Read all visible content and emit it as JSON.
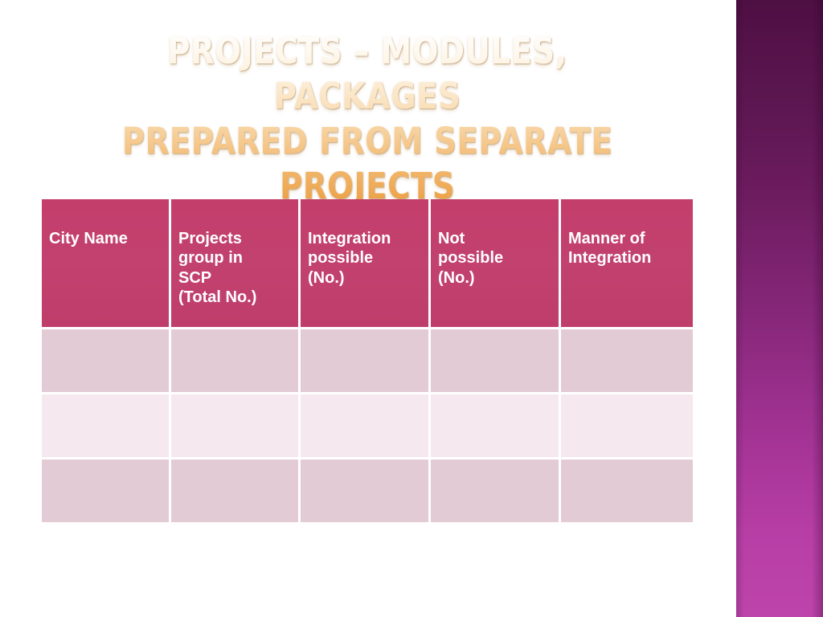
{
  "slide": {
    "title": "Projects – Modules, packages prepared from separate projects",
    "title_lines": "PROJECTS – MODULES, PACKAGES\nPREPARED FROM SEPARATE\nPROJECTS",
    "background_color": "#ffffff"
  },
  "decor": {
    "side_band_name": "purple-gradient-band",
    "side_band_top_color": "#4e0f43",
    "side_band_bottom_color": "#bd44aa"
  },
  "table": {
    "header_bg_color": "#c2406a",
    "header_text_color": "#ffffff",
    "row_dark_color": "#e3cbd5",
    "row_light_color": "#f5e8ee",
    "grid_line_color": "#ffffff",
    "columns": [
      "City Name",
      "Projects\ngroup in\nSCP\n(Total No.)",
      "Integration\npossible\n(No.)",
      "Not\npossible\n(No.)",
      "Manner of\nIntegration"
    ],
    "rows": [
      [
        "",
        "",
        "",
        "",
        ""
      ],
      [
        "",
        "",
        "",
        "",
        ""
      ],
      [
        "",
        "",
        "",
        "",
        ""
      ]
    ]
  }
}
